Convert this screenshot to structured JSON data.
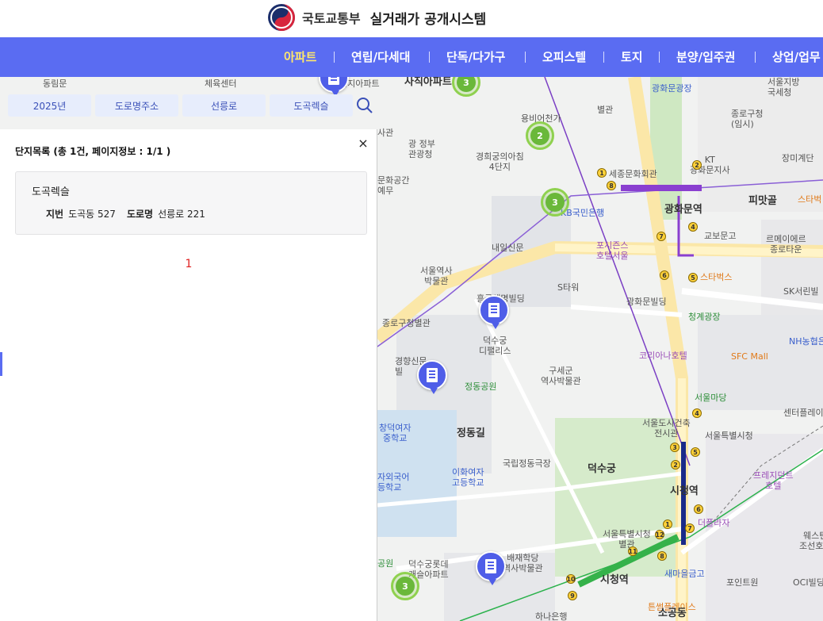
{
  "header": {
    "ministry": "국토교통부",
    "system_title": "실거래가 공개시스템"
  },
  "nav": {
    "items": [
      {
        "label": "아파트",
        "active": true
      },
      {
        "label": "연립/다세대",
        "active": false
      },
      {
        "label": "단독/다가구",
        "active": false
      },
      {
        "label": "오피스텔",
        "active": false
      },
      {
        "label": "토지",
        "active": false
      },
      {
        "label": "분양/입주권",
        "active": false
      },
      {
        "label": "상업/업무",
        "active": false
      }
    ]
  },
  "filters": {
    "year": "2025년",
    "address_type": "도로명주소",
    "road": "선릉로",
    "complex": "도곡렉슬"
  },
  "panel": {
    "title": "단지목록 (총 1건, 페이지정보 : 1/1 )",
    "close_icon": "×",
    "results": [
      {
        "name": "도곡렉슬",
        "jibun_label": "지번",
        "jibun": "도곡동 527",
        "road_label": "도로명",
        "road": "선릉로 221"
      }
    ],
    "current_page": "1"
  },
  "map": {
    "labels": {
      "l1": "체육센터",
      "l2": "단지아파트",
      "l3": "광화문광장",
      "l4": "서울지방\n국세청",
      "l5": "별관",
      "l6": "종로구청\n(임시)",
      "l7": "용비어천가",
      "l8": "광 정부\n관광청",
      "l9": "경희궁의아침\n4단지",
      "l10": "세종문화회관",
      "l11": "KT\n광화문지사",
      "l12": "장미계단",
      "l13": "피맛골",
      "l14": "스타벅",
      "l15": "KB국민은행",
      "l16": "광화문역",
      "l17": "교보문고",
      "l18": "르메이에르\n종로타운",
      "l19": "내일신문",
      "l20": "포시즌스\n호텔서울",
      "l21": "스타벅스",
      "l22": "서울역사\n박물관",
      "l23": "S타워",
      "l24": "SK서린빌",
      "l25": "흥국생명빌딩",
      "l26": "광화문빌딩",
      "l27": "청계광장",
      "l28": "종로구청별관",
      "l29": "덕수궁\n디팰리스",
      "l30": "코리아나호텔",
      "l31": "NH농협은",
      "l32": "SFC Mall",
      "l33": "경향신문\n빌",
      "l34": "구세군\n역사박물관",
      "l35": "정동공원",
      "l36": "서울마당",
      "l37": "센터플레이",
      "l38": "창덕여자\n중학교",
      "l39": "정동길",
      "l40": "서울도시건축\n전시관",
      "l41": "서울특별시청",
      "l42": "국립정동극장",
      "l43": "덕수궁",
      "l44": "자외국어\n등학교",
      "l45": "이화여자\n고등학교",
      "l46": "시청역",
      "l47": "프레지던트\n호텔",
      "l48": "더플라자",
      "l49": "웨스틴\n조선호텔",
      "l50": "서울특별시청\n별관",
      "l51": "배재학당\n역사박물관",
      "l52": "덕수궁롯데\n캐슬아파트",
      "l53": "새마을금고",
      "l54": "포인트원",
      "l55": "OCI빌딩",
      "l56": "공원",
      "l57": "시청역",
      "l58": "튼썸플레이스",
      "l59": "하나은행",
      "l60": "소공동",
      "l61": "동림문",
      "l62": "사직아파트",
      "l63": "문화공간\n예무",
      "l64": "사관"
    },
    "clusters": [
      "3",
      "2",
      "3",
      "3"
    ]
  },
  "colors": {
    "nav_bg": "#5a6cf2",
    "nav_active": "#ffe86b",
    "chip_bg": "#e7edfc",
    "pager": "#e02020"
  }
}
